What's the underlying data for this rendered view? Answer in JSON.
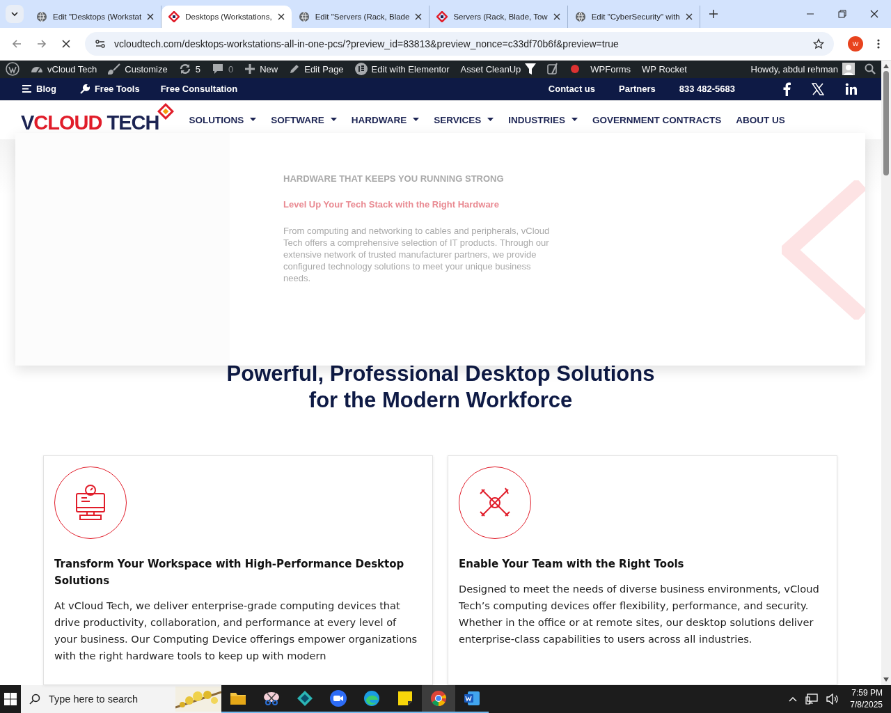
{
  "browser": {
    "tabs": [
      {
        "title": "Edit \"Desktops (Workstat",
        "kind": "globe",
        "selected": false
      },
      {
        "title": "Desktops (Workstations,",
        "kind": "site",
        "selected": true
      },
      {
        "title": "Edit \"Servers (Rack, Blade",
        "kind": "globe",
        "selected": false
      },
      {
        "title": "Servers (Rack, Blade, Tow",
        "kind": "site",
        "selected": false
      },
      {
        "title": "Edit \"CyberSecurity\" with",
        "kind": "globe",
        "selected": false
      }
    ],
    "address": "vcloudtech.com/desktops-workstations-all-in-one-pcs/?preview_id=83813&preview_nonce=c33df70b6f&preview=true",
    "profile_initial": "W"
  },
  "admin_bar": {
    "items": [
      {
        "kind": "wp"
      },
      {
        "kind": "dashboard",
        "label": "vCloud Tech"
      },
      {
        "kind": "brush",
        "label": "Customize"
      },
      {
        "kind": "updates",
        "label": "5"
      },
      {
        "kind": "comments",
        "label": "0"
      },
      {
        "kind": "plus",
        "label": "New"
      },
      {
        "kind": "pencil",
        "label": "Edit Page"
      },
      {
        "kind": "elementor",
        "label": "Edit with Elementor"
      },
      {
        "kind": "filter",
        "label": "Asset CleanUp"
      },
      {
        "kind": "yoast"
      },
      {
        "kind": "dot",
        "color": "#dc3232"
      },
      {
        "kind": "text",
        "label": "WPForms"
      },
      {
        "kind": "text",
        "label": "WP Rocket"
      }
    ],
    "howdy": "Howdy, abdul rehman"
  },
  "top_bar": {
    "left_links": [
      {
        "kind": "menu",
        "label": "Blog"
      },
      {
        "kind": "wrench",
        "label": "Free Tools"
      },
      {
        "kind": "plain",
        "label": "Free Consultation"
      }
    ],
    "right_links": [
      {
        "label": "Contact us"
      },
      {
        "label": "Partners"
      },
      {
        "label": "833 482-5683"
      }
    ],
    "social": [
      {
        "kind": "facebook"
      },
      {
        "kind": "x"
      },
      {
        "kind": "linkedin"
      }
    ]
  },
  "nav": {
    "logo": [
      {
        "text": "V",
        "color": "#1c2453"
      },
      {
        "text": "CLOUD",
        "color": "#e11d2a"
      },
      {
        "text": " TECH",
        "color": "#1c2453"
      }
    ],
    "items": [
      {
        "label": "SOLUTIONS",
        "has_dropdown": true
      },
      {
        "label": "SOFTWARE",
        "has_dropdown": true
      },
      {
        "label": "HARDWARE",
        "has_dropdown": true
      },
      {
        "label": "SERVICES",
        "has_dropdown": true
      },
      {
        "label": "INDUSTRIES",
        "has_dropdown": true
      },
      {
        "label": "GOVERNMENT CONTRACTS",
        "has_dropdown": false
      },
      {
        "label": "ABOUT US",
        "has_dropdown": false
      }
    ]
  },
  "mega_menu": {
    "eyebrow": "HARDWARE THAT KEEPS YOU RUNNING STRONG",
    "title": "Level Up Your Tech Stack with the Right Hardware",
    "text": "From computing and networking to cables and peripherals, vCloud Tech offers a comprehensive selection of IT products. Through our extensive network of trusted manufacturer partners, we provide configured technology solutions to meet your unique business needs."
  },
  "heading": [
    "Powerful, Professional Desktop Solutions",
    "for the Modern Workforce"
  ],
  "cards": [
    {
      "kind": "computer",
      "title": "Transform Your Workspace with High-Performance Desktop Solutions",
      "text": "At vCloud Tech, we deliver enterprise-grade computing devices that drive productivity, collaboration, and performance at every level of your business. Our Computing Device offerings empower organizations with the right hardware tools to keep up with modern"
    },
    {
      "kind": "tools",
      "title": "Enable Your Team with the Right Tools",
      "text": "Designed to meet the needs of diverse business environments, vCloud Tech’s computing devices offer flexibility, performance, and security. Whether in the office or at remote sites, our desktop solutions deliver enterprise-class capabilities to users across all industries."
    }
  ],
  "taskbar": {
    "search_placeholder": "Type here to search",
    "apps": [
      {
        "kind": "folder",
        "selected": false
      },
      {
        "kind": "snip",
        "selected": false
      },
      {
        "kind": "cube",
        "selected": false
      },
      {
        "kind": "zoom",
        "selected": false
      },
      {
        "kind": "edge",
        "selected": false
      },
      {
        "kind": "notes",
        "selected": false
      },
      {
        "kind": "chrome",
        "selected": true
      },
      {
        "kind": "word",
        "selected": false
      }
    ],
    "time": "7:59 PM",
    "date": "7/8/2025"
  }
}
